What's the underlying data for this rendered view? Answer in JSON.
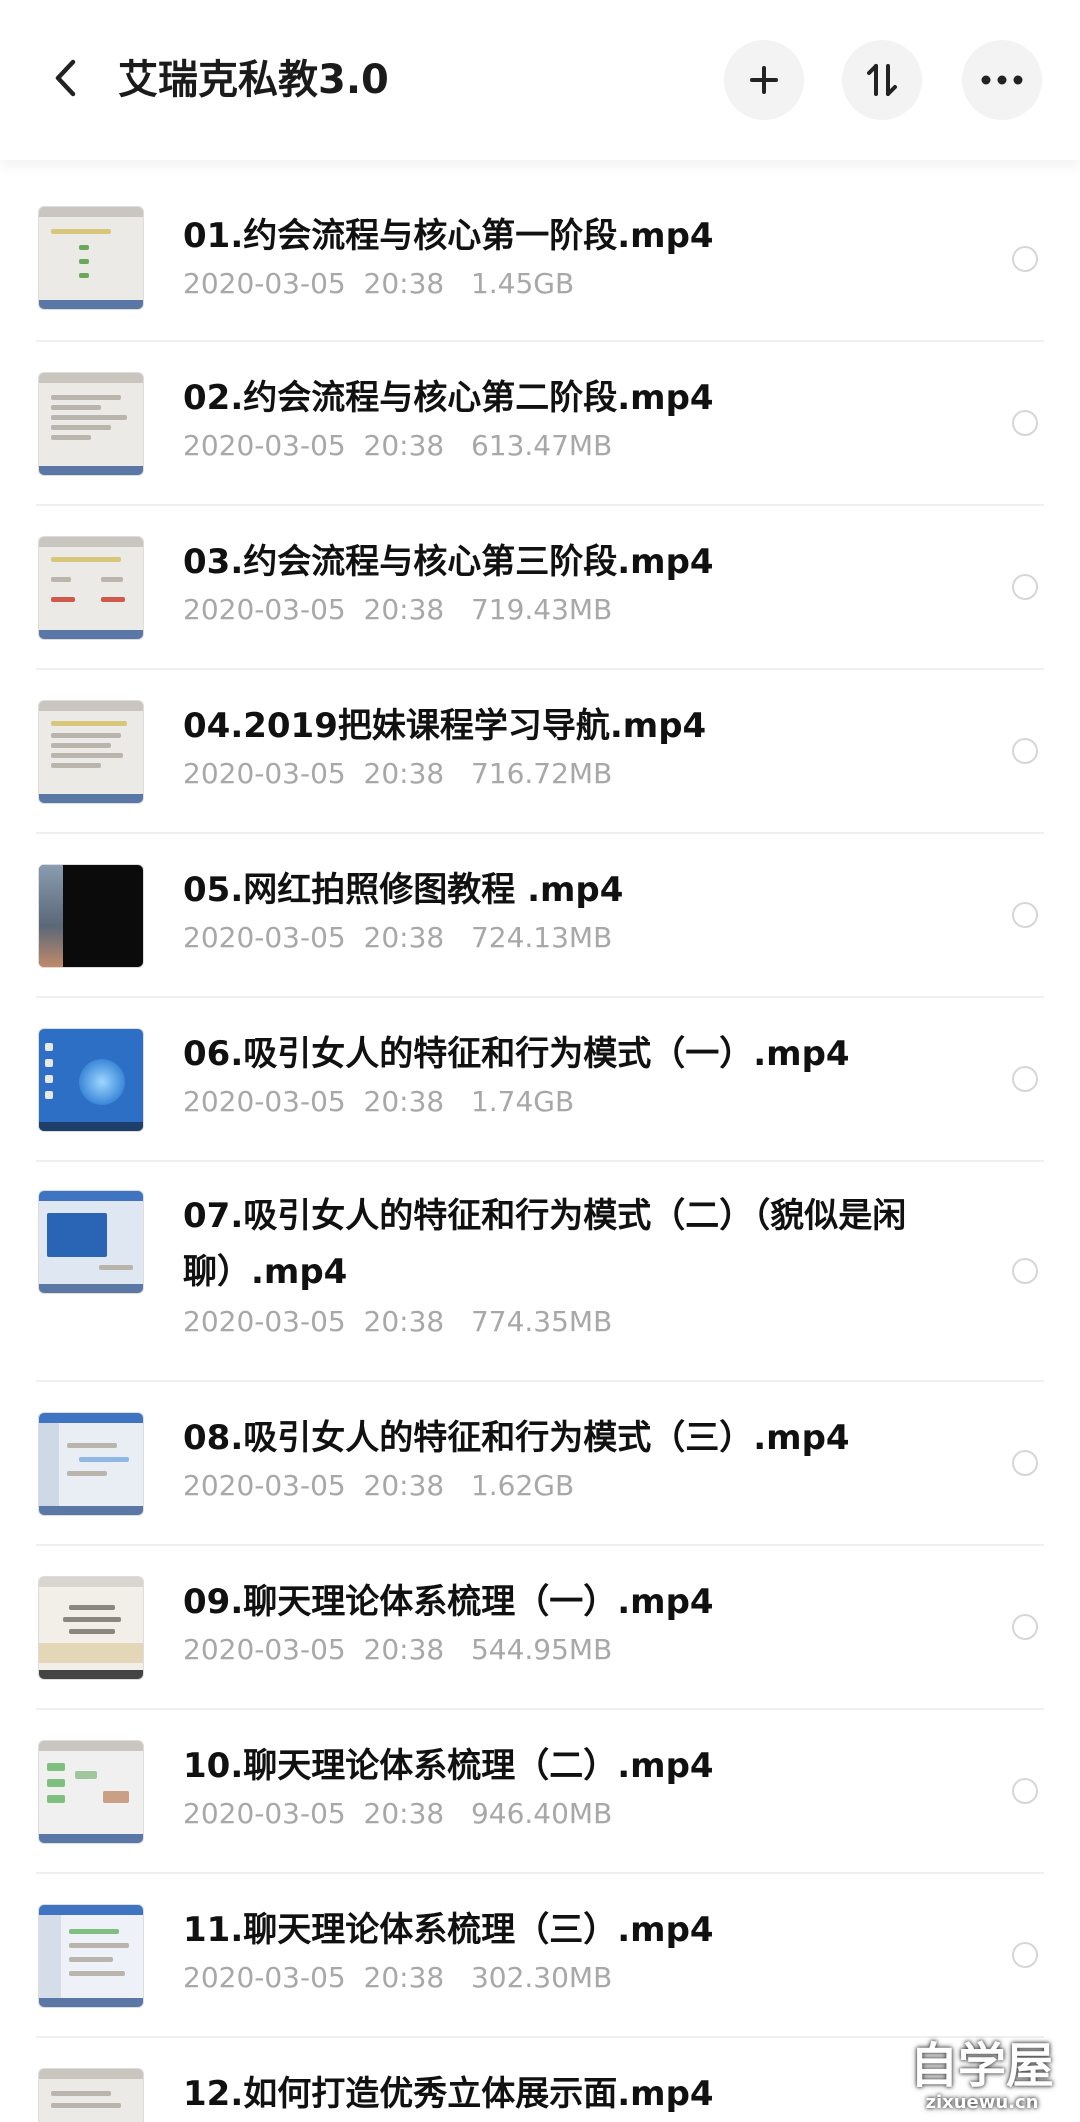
{
  "header": {
    "title": "艾瑞克私教3.0",
    "back_icon": "chevron-left-icon",
    "add_icon": "plus-icon",
    "sort_icon": "sort-icon",
    "more_icon": "more-icon"
  },
  "files": [
    {
      "name": "01.约会流程与核心第一阶段.mp4",
      "date": "2020-03-05",
      "time": "20:38",
      "size": "1.45GB"
    },
    {
      "name": "02.约会流程与核心第二阶段.mp4",
      "date": "2020-03-05",
      "time": "20:38",
      "size": "613.47MB"
    },
    {
      "name": "03.约会流程与核心第三阶段.mp4",
      "date": "2020-03-05",
      "time": "20:38",
      "size": "719.43MB"
    },
    {
      "name": "04.2019把妹课程学习导航.mp4",
      "date": "2020-03-05",
      "time": "20:38",
      "size": "716.72MB"
    },
    {
      "name": "05.网红拍照修图教程 .mp4",
      "date": "2020-03-05",
      "time": "20:38",
      "size": "724.13MB"
    },
    {
      "name": "06.吸引女人的特征和行为模式（一）.mp4",
      "date": "2020-03-05",
      "time": "20:38",
      "size": "1.74GB"
    },
    {
      "name": "07.吸引女人的特征和行为模式（二）（貌似是闲聊）.mp4",
      "date": "2020-03-05",
      "time": "20:38",
      "size": "774.35MB"
    },
    {
      "name": "08.吸引女人的特征和行为模式（三）.mp4",
      "date": "2020-03-05",
      "time": "20:38",
      "size": "1.62GB"
    },
    {
      "name": "09.聊天理论体系梳理（一）.mp4",
      "date": "2020-03-05",
      "time": "20:38",
      "size": "544.95MB"
    },
    {
      "name": "10.聊天理论体系梳理（二）.mp4",
      "date": "2020-03-05",
      "time": "20:38",
      "size": "946.40MB"
    },
    {
      "name": "11.聊天理论体系梳理（三）.mp4",
      "date": "2020-03-05",
      "time": "20:38",
      "size": "302.30MB"
    },
    {
      "name": "12.如何打造优秀立体展示面.mp4"
    }
  ],
  "watermark": {
    "main": "自学屋",
    "sub": "zixuewu.cn"
  }
}
